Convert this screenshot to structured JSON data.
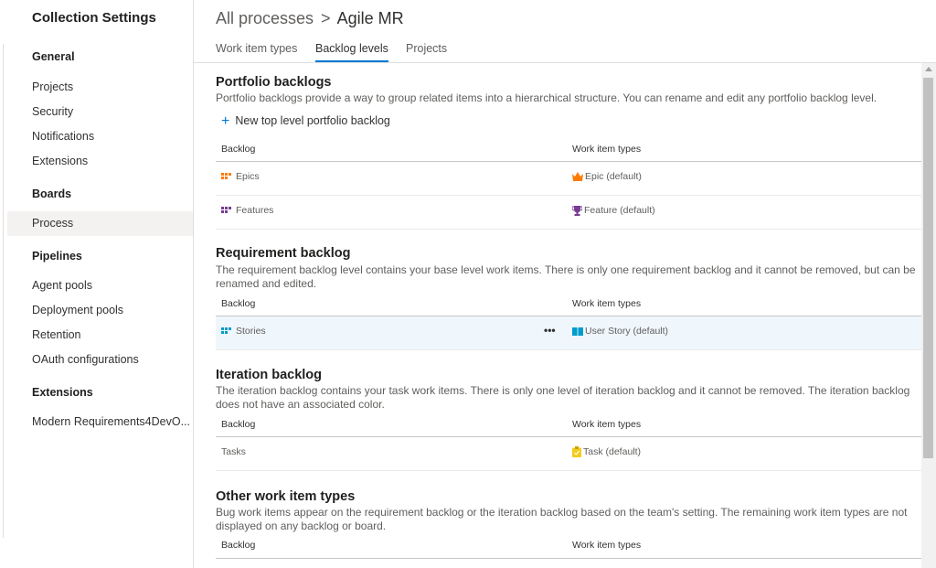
{
  "sidebar": {
    "title": "Collection Settings",
    "sections": [
      {
        "heading": "General",
        "items": [
          "Projects",
          "Security",
          "Notifications",
          "Extensions"
        ]
      },
      {
        "heading": "Boards",
        "items": [
          "Process"
        ]
      },
      {
        "heading": "Pipelines",
        "items": [
          "Agent pools",
          "Deployment pools",
          "Retention",
          "OAuth configurations"
        ]
      },
      {
        "heading": "Extensions",
        "items": [
          "Modern Requirements4DevO..."
        ]
      }
    ],
    "selected_item": "Process"
  },
  "breadcrumb": {
    "root": "All processes",
    "separator": ">",
    "current": "Agile MR"
  },
  "tabs": [
    "Work item types",
    "Backlog levels",
    "Projects"
  ],
  "active_tab": "Backlog levels",
  "columns": {
    "backlog": "Backlog",
    "work_item_types": "Work item types"
  },
  "portfolio": {
    "title": "Portfolio backlogs",
    "description": "Portfolio backlogs provide a way to group related items into a hierarchical structure. You can rename and edit any portfolio backlog level.",
    "new_button": "New top level portfolio backlog",
    "rows": [
      {
        "backlog": "Epics",
        "type": "Epic (default)",
        "color": "#ff7b00",
        "type_icon": "crown-icon"
      },
      {
        "backlog": "Features",
        "type": "Feature (default)",
        "color": "#773b93",
        "type_icon": "trophy-icon"
      }
    ]
  },
  "requirement": {
    "title": "Requirement backlog",
    "description": "The requirement backlog level contains your base level work items. There is only one requirement backlog and it cannot be removed, but can be renamed and edited.",
    "rows": [
      {
        "backlog": "Stories",
        "type": "User Story (default)",
        "color": "#009ccc",
        "type_icon": "book-icon",
        "more": "•••"
      }
    ]
  },
  "iteration": {
    "title": "Iteration backlog",
    "description": "The iteration backlog contains your task work items. There is only one level of iteration backlog and it cannot be removed. The iteration backlog does not have an associated color.",
    "rows": [
      {
        "backlog": "Tasks",
        "type": "Task (default)",
        "color": "#f2cb1d",
        "type_icon": "clipboard-icon"
      }
    ]
  },
  "other": {
    "title": "Other work item types",
    "description": "Bug work items appear on the requirement backlog or the iteration backlog based on the team's setting. The remaining work item types are not displayed on any backlog or board."
  }
}
